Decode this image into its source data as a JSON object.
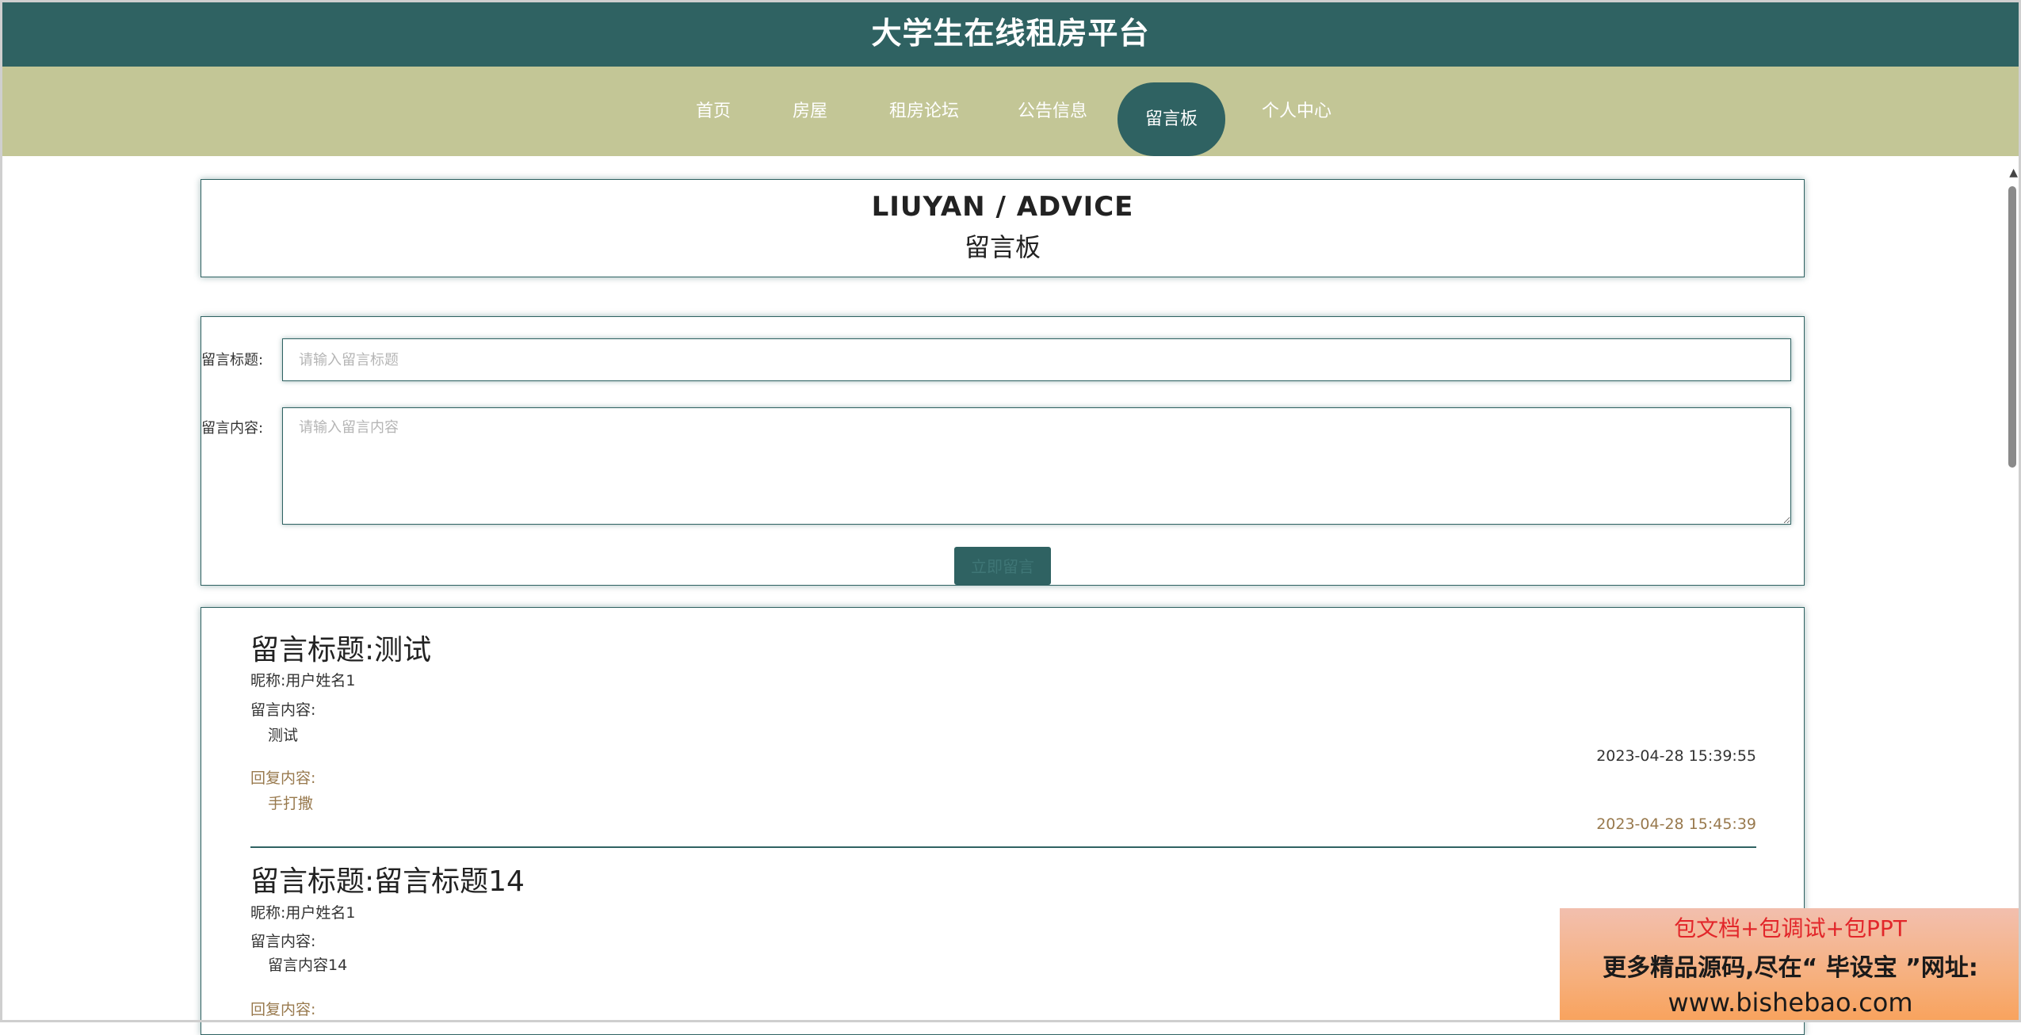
{
  "header": {
    "title": "大学生在线租房平台"
  },
  "nav": {
    "items": [
      "首页",
      "房屋",
      "租房论坛",
      "公告信息",
      "留言板",
      "个人中心"
    ],
    "active": "留言板"
  },
  "title_card": {
    "en": "LIUYAN / ADVICE",
    "cn": "留言板"
  },
  "form": {
    "title_label": "留言标题:",
    "title_placeholder": "请输入留言标题",
    "content_label": "留言内容:",
    "content_placeholder": "请输入留言内容",
    "submit_label": "立即留言"
  },
  "messages": [
    {
      "title": "留言标题:测试",
      "nickname": "昵称:用户姓名1",
      "content_label": "留言内容:",
      "content": "测试",
      "time": "2023-04-28 15:39:55",
      "reply_label": "回复内容:",
      "reply": "手打撒",
      "reply_time": "2023-04-28 15:45:39"
    },
    {
      "title": "留言标题:留言标题14",
      "nickname": "昵称:用户姓名1",
      "content_label": "留言内容:",
      "content": "留言内容14",
      "reply_label": "回复内容:"
    }
  ],
  "ad": {
    "line1": "包文档+包调试+包PPT",
    "line2": "更多精品源码,尽在“ 毕设宝 ”网址:",
    "line3": "www.bishebao.com"
  },
  "colors": {
    "primary": "#2f6262",
    "nav_bg": "#c3c696",
    "reply": "#98794d"
  }
}
